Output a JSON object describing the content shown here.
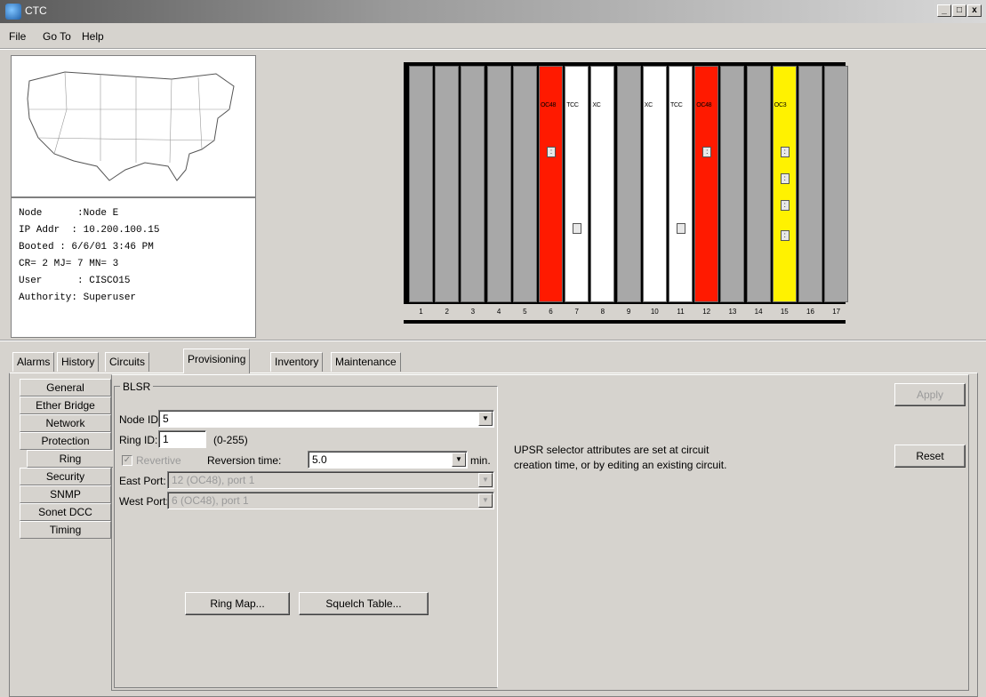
{
  "window": {
    "title": "CTC",
    "min": "_",
    "max": "□",
    "close": "x"
  },
  "menu": [
    "File",
    "Go To",
    "Help"
  ],
  "node_info": {
    "node": "Node      :Node E",
    "ip": "IP Addr  : 10.200.100.15",
    "booted": "Booted : 6/6/01 3:46 PM",
    "counts": "CR= 2 MJ= 7 MN= 3",
    "user": "User      : CISCO15",
    "authority": "Authority: Superuser"
  },
  "shelf": {
    "slots": [
      {
        "num": "1",
        "color": "gray",
        "label": ""
      },
      {
        "num": "2",
        "color": "gray",
        "label": ""
      },
      {
        "num": "3",
        "color": "gray",
        "label": ""
      },
      {
        "num": "4",
        "color": "gray",
        "label": ""
      },
      {
        "num": "5",
        "color": "gray",
        "label": ""
      },
      {
        "num": "6",
        "color": "red",
        "label": "OC48"
      },
      {
        "num": "7",
        "color": "white",
        "label": "TCC"
      },
      {
        "num": "8",
        "color": "white",
        "label": "XC"
      },
      {
        "num": "9",
        "color": "gray",
        "label": ""
      },
      {
        "num": "10",
        "color": "white",
        "label": "XC"
      },
      {
        "num": "11",
        "color": "white",
        "label": "TCC"
      },
      {
        "num": "12",
        "color": "red",
        "label": "OC48"
      },
      {
        "num": "13",
        "color": "gray",
        "label": ""
      },
      {
        "num": "14",
        "color": "gray",
        "label": ""
      },
      {
        "num": "15",
        "color": "yellow",
        "label": "OC3"
      },
      {
        "num": "16",
        "color": "gray",
        "label": ""
      },
      {
        "num": "17",
        "color": "gray",
        "label": ""
      }
    ]
  },
  "tabs": [
    "Alarms",
    "History",
    "Circuits",
    "Provisioning",
    "Inventory",
    "Maintenance"
  ],
  "subtabs": [
    "General",
    "Ether Bridge",
    "Network",
    "Protection",
    "Ring",
    "Security",
    "SNMP",
    "Sonet DCC",
    "Timing"
  ],
  "blsr": {
    "legend": "BLSR",
    "node_id_label": "Node ID:",
    "node_id_value": "5",
    "ring_id_label": "Ring ID:",
    "ring_id_value": "1",
    "ring_id_range": "(0-255)",
    "revertive_label": "Revertive",
    "reversion_time_label": "Reversion time:",
    "reversion_time_value": "5.0",
    "reversion_unit": "min.",
    "east_port_label": "East Port:",
    "east_port_value": "12 (OC48), port 1",
    "west_port_label": "West Port:",
    "west_port_value": "6 (OC48), port 1",
    "ring_map_button": "Ring Map...",
    "squelch_table_button": "Squelch Table..."
  },
  "upsr_note": "UPSR selector attributes are set at circuit creation time, or by editing an existing circuit.",
  "apply_button": "Apply",
  "reset_button": "Reset",
  "colors": {
    "red": "#ff1a00",
    "yellow": "#fff200",
    "gray": "#a8a8a8",
    "white": "#ffffff"
  }
}
